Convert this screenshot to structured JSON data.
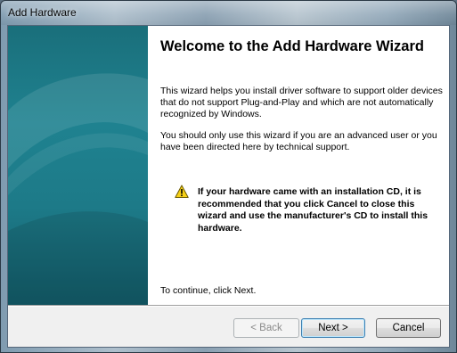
{
  "window": {
    "title": "Add Hardware"
  },
  "wizard": {
    "heading": "Welcome to the Add Hardware Wizard",
    "intro": "This wizard helps you install driver software to support older devices that do not support Plug-and-Play and which are not automatically recognized by Windows.",
    "advanced_note": "You should only use this wizard if you are an advanced user or you have been directed here by technical support.",
    "warning_icon": "warning-triangle-icon",
    "warning": "If your hardware came with an installation CD, it is recommended that you click Cancel to close this wizard and use the manufacturer's CD to install this hardware.",
    "continue_hint": "To continue, click Next."
  },
  "buttons": {
    "back": "< Back",
    "next": "Next >",
    "cancel": "Cancel"
  },
  "colors": {
    "sidebar": "#1f8290",
    "accent_focus": "#3c7fb1",
    "warning_yellow": "#f7d117"
  }
}
